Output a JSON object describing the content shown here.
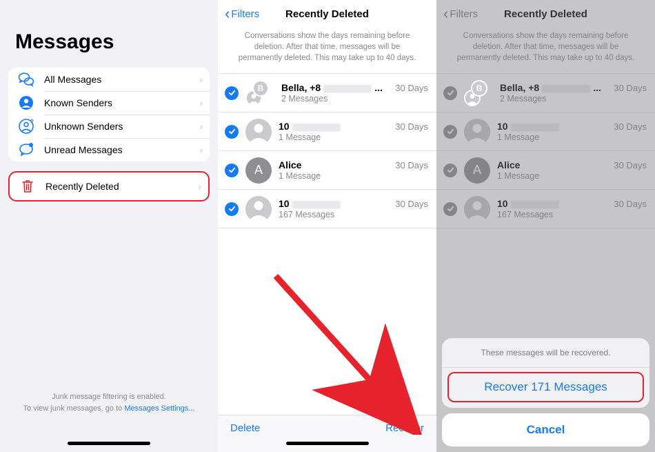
{
  "panel1": {
    "title": "Messages",
    "filters": [
      {
        "label": "All Messages",
        "icon": "bubbles"
      },
      {
        "label": "Known Senders",
        "icon": "person"
      },
      {
        "label": "Unknown Senders",
        "icon": "person-q"
      },
      {
        "label": "Unread Messages",
        "icon": "bubble-dot"
      }
    ],
    "deleted": {
      "label": "Recently Deleted",
      "icon": "trash"
    },
    "footer_line1": "Junk message filtering is enabled.",
    "footer_line2_a": "To view junk messages, go to ",
    "footer_link": "Messages Settings..."
  },
  "panel2": {
    "back": "Filters",
    "title": "Recently Deleted",
    "info": "Conversations show the days remaining before deletion. After that time, messages will be permanently deleted. This may take up to 40 days.",
    "rows": [
      {
        "name": "Bella, +8",
        "blur": true,
        "dots": true,
        "sub": "2 Messages",
        "days": "30 Days",
        "avatar": "group",
        "letter": "B"
      },
      {
        "name": "10",
        "blur": true,
        "sub": "1 Message",
        "days": "30 Days",
        "avatar": "person"
      },
      {
        "name": "Alice",
        "sub": "1 Message",
        "days": "30 Days",
        "avatar": "letter",
        "letter": "A"
      },
      {
        "name": "10",
        "blur": true,
        "sub": "167 Messages",
        "days": "30 Days",
        "avatar": "person"
      }
    ],
    "delete": "Delete",
    "recover": "Recover"
  },
  "panel3": {
    "back": "Filters",
    "title": "Recently Deleted",
    "info": "Conversations show the days remaining before deletion. After that time, messages will be permanently deleted. This may take up to 40 days.",
    "rows": [
      {
        "name": "Bella, +8",
        "blur": true,
        "dots": true,
        "sub": "2 Messages",
        "days": "30 Days",
        "avatar": "group",
        "letter": "B"
      },
      {
        "name": "10",
        "blur": true,
        "sub": "1 Message",
        "days": "30 Days",
        "avatar": "person"
      },
      {
        "name": "Alice",
        "sub": "1 Message",
        "days": "30 Days",
        "avatar": "letter",
        "letter": "A"
      },
      {
        "name": "10",
        "blur": true,
        "sub": "167 Messages",
        "days": "30 Days",
        "avatar": "person"
      }
    ],
    "sheet": {
      "msg": "These messages will be recovered.",
      "action": "Recover 171 Messages",
      "cancel": "Cancel"
    }
  }
}
